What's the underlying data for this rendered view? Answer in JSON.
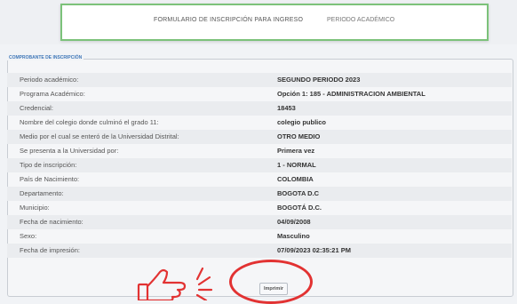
{
  "header": {
    "title": "FORMULARIO DE INSCRIPCIÓN PARA INGRESO",
    "period": "PERIODO ACADÉMICO"
  },
  "panel": {
    "legend": "COMPROBANTE DE INSCRIPCIÓN",
    "rows": [
      {
        "label": "Periodo académico:",
        "value": "SEGUNDO PERIODO 2023"
      },
      {
        "label": "Programa Académico:",
        "value": "Opción 1: 185 - ADMINISTRACION AMBIENTAL"
      },
      {
        "label": "Credencial:",
        "value": "18453"
      },
      {
        "label": "Nombre del colegio donde culminó el grado 11:",
        "value": "colegio publico"
      },
      {
        "label": "Medio por el cual se enteró de la Universidad Distrital:",
        "value": "OTRO MEDIO"
      },
      {
        "label": "Se presenta a la Universidad por:",
        "value": "Primera vez"
      },
      {
        "label": "Tipo de inscripción:",
        "value": "1 - NORMAL"
      },
      {
        "label": "País de Nacimiento:",
        "value": "COLOMBIA"
      },
      {
        "label": "Departamento:",
        "value": "BOGOTA D.C"
      },
      {
        "label": "Municipio:",
        "value": "BOGOTÁ D.C."
      },
      {
        "label": "Fecha de nacimiento:",
        "value": "04/09/2008"
      },
      {
        "label": "Sexo:",
        "value": "Masculino"
      },
      {
        "label": "Fecha de impresión:",
        "value": "07/09/2023 02:35:21 PM"
      }
    ]
  },
  "actions": {
    "print_label": "Imprimir"
  },
  "colors": {
    "header_border": "#7cc27a",
    "legend": "#3f77b8",
    "highlight": "#e23232"
  }
}
